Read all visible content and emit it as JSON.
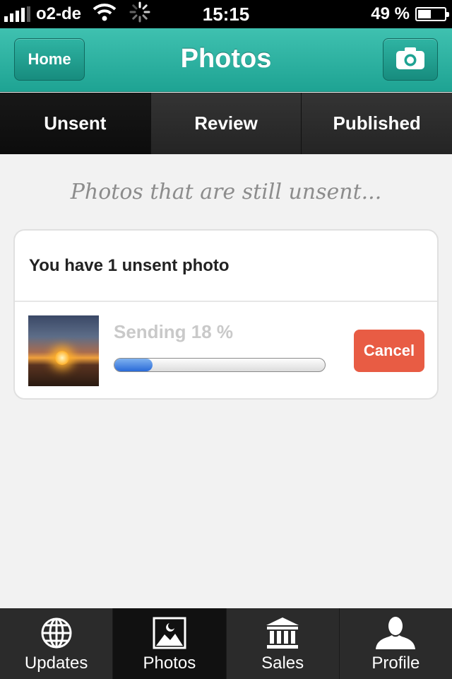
{
  "status_bar": {
    "carrier": "o2-de",
    "time": "15:15",
    "battery": "49 %",
    "battery_level": 0.49,
    "icons": [
      "signal-icon",
      "wifi-icon",
      "activity-spinner-icon",
      "battery-icon"
    ]
  },
  "navbar": {
    "title": "Photos",
    "home_label": "Home",
    "camera_icon": "camera-icon"
  },
  "segments": [
    {
      "label": "Unsent",
      "active": true
    },
    {
      "label": "Review",
      "active": false
    },
    {
      "label": "Published",
      "active": false
    }
  ],
  "content": {
    "subtitle": "Photos that are still unsent...",
    "card": {
      "title": "You have 1 unsent photo",
      "item": {
        "status": "Sending 18 %",
        "progress": 0.18,
        "cancel_label": "Cancel",
        "thumbnail": "sunset-photo-thumbnail"
      }
    }
  },
  "tabbar": [
    {
      "label": "Updates",
      "icon": "globe-icon",
      "active": false
    },
    {
      "label": "Photos",
      "icon": "photo-icon",
      "active": true
    },
    {
      "label": "Sales",
      "icon": "bank-icon",
      "active": false
    },
    {
      "label": "Profile",
      "icon": "person-icon",
      "active": false
    }
  ],
  "colors": {
    "nav_teal": "#1ea393",
    "cancel_red": "#e85c44",
    "progress_blue": "#2a6ad8"
  }
}
